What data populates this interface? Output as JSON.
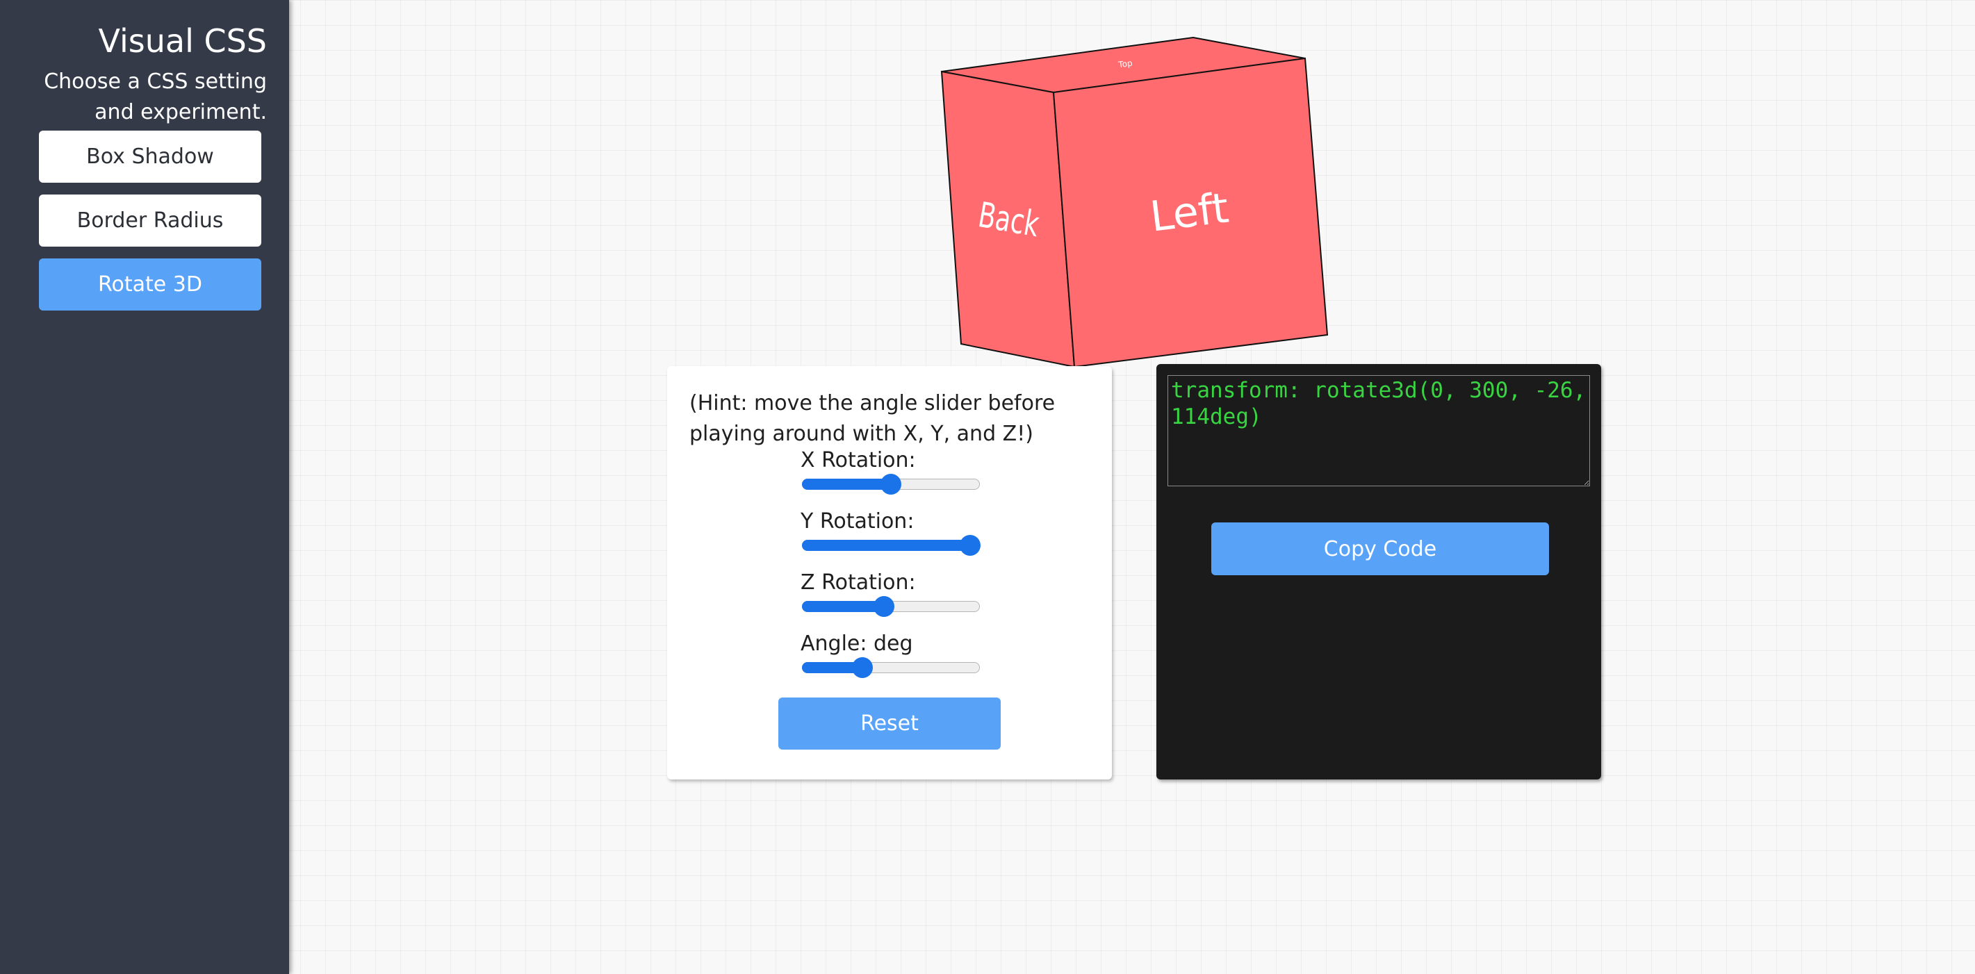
{
  "sidebar": {
    "title": "Visual CSS",
    "subtitle": "Choose a CSS setting and experiment.",
    "items": [
      {
        "label": "Box Shadow",
        "active": false
      },
      {
        "label": "Border Radius",
        "active": false
      },
      {
        "label": "Rotate 3D",
        "active": true
      }
    ]
  },
  "cube": {
    "color": "#ff6b6e",
    "faces": {
      "back": "Back",
      "left": "Left",
      "top": "Top"
    }
  },
  "controls": {
    "hint": "(Hint: move the angle slider before playing around with X, Y, and Z!)",
    "sliders": [
      {
        "label": "X Rotation:",
        "fraction": 0.5
      },
      {
        "label": "Y Rotation:",
        "fraction": 0.95
      },
      {
        "label": "Z Rotation:",
        "fraction": 0.46
      },
      {
        "label": "Angle: deg",
        "fraction": 0.34
      }
    ],
    "reset_label": "Reset"
  },
  "code": {
    "text": "transform: rotate3d(0, 300, -26, 114deg)",
    "copy_label": "Copy Code"
  },
  "colors": {
    "accent": "#58a2f8",
    "slider": "#1a73e8",
    "sidebar_bg": "#343a48",
    "code_text": "#39d441"
  }
}
